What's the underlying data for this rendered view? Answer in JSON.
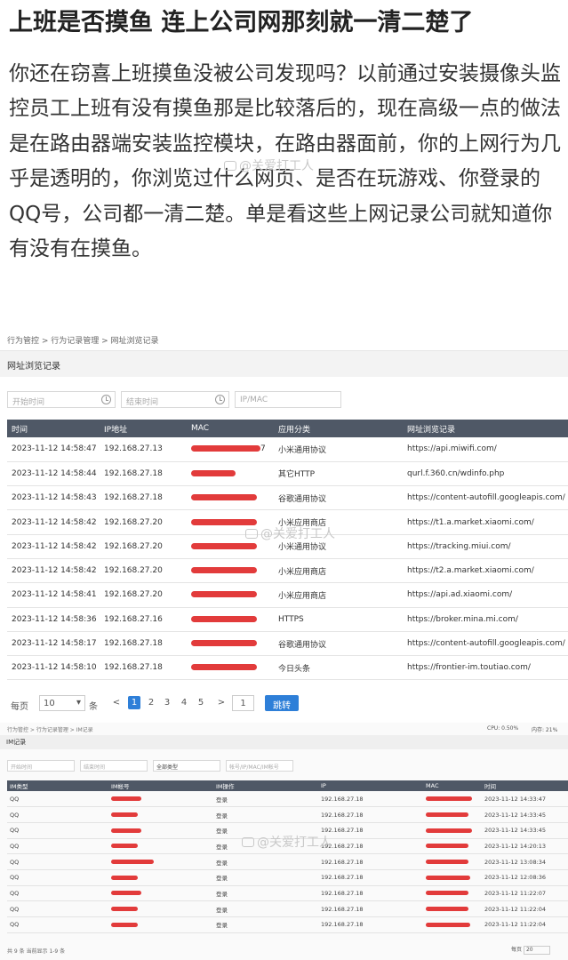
{
  "article": {
    "headline": "上班是否摸鱼 连上公司网那刻就一清二楚了",
    "body": "你还在窃喜上班摸鱼没被公司发现吗？以前通过安装摄像头监控员工上班有没有摸鱼那是比较落后的，现在高级一点的做法是在路由器端安装监控模块，在路由器面前，你的上网行为几乎是透明的，你浏览过什么网页、是否在玩游戏、你登录的QQ号，公司都一清二楚。单是看这些上网记录公司就知道你有没有在摸鱼。"
  },
  "watermark": "@关爱打工人",
  "url_panel": {
    "breadcrumb": "行为管控 > 行为记录管理 > 网址浏览记录",
    "section_title": "网址浏览记录",
    "filters": {
      "start": "开始时间",
      "end": "结束时间",
      "ipmac": "IP/MAC"
    },
    "columns": [
      "时间",
      "IP地址",
      "MAC",
      "应用分类",
      "网址浏览记录"
    ],
    "rows": [
      {
        "time": "2023-11-12 14:58:47",
        "ip": "192.168.27.13",
        "mac_tail": "7",
        "app": "小米通用协议",
        "url": "https://api.miwifi.com/"
      },
      {
        "time": "2023-11-12 14:58:44",
        "ip": "192.168.27.18",
        "mac_tail": "",
        "app": "其它HTTP",
        "url": "qurl.f.360.cn/wdinfo.php"
      },
      {
        "time": "2023-11-12 14:58:43",
        "ip": "192.168.27.18",
        "mac_tail": "",
        "app": "谷歌通用协议",
        "url": "https://content-autofill.googleapis.com/"
      },
      {
        "time": "2023-11-12 14:58:42",
        "ip": "192.168.27.20",
        "mac_tail": "",
        "app": "小米应用商店",
        "url": "https://t1.a.market.xiaomi.com/"
      },
      {
        "time": "2023-11-12 14:58:42",
        "ip": "192.168.27.20",
        "mac_tail": "",
        "app": "小米通用协议",
        "url": "https://tracking.miui.com/"
      },
      {
        "time": "2023-11-12 14:58:42",
        "ip": "192.168.27.20",
        "mac_tail": "",
        "app": "小米应用商店",
        "url": "https://t2.a.market.xiaomi.com/"
      },
      {
        "time": "2023-11-12 14:58:41",
        "ip": "192.168.27.20",
        "mac_tail": "",
        "app": "小米应用商店",
        "url": "https://api.ad.xiaomi.com/"
      },
      {
        "time": "2023-11-12 14:58:36",
        "ip": "192.168.27.16",
        "mac_tail": "",
        "app": "HTTPS",
        "url": "https://broker.mina.mi.com/"
      },
      {
        "time": "2023-11-12 14:58:17",
        "ip": "192.168.27.18",
        "mac_tail": "",
        "app": "谷歌通用协议",
        "url": "https://content-autofill.googleapis.com/"
      },
      {
        "time": "2023-11-12 14:58:10",
        "ip": "192.168.27.18",
        "mac_tail": "",
        "app": "今日头条",
        "url": "https://frontier-im.toutiao.com/"
      }
    ],
    "pagination": {
      "per_page_label": "每页",
      "per_page_value": "10",
      "unit": "条",
      "prev": "<",
      "next": ">",
      "pages": [
        "1",
        "2",
        "3",
        "4",
        "5"
      ],
      "current": "1",
      "goto_value": "1",
      "jump_label": "跳转"
    }
  },
  "im_panel": {
    "breadcrumb": "行为管控 > 行为记录管理 > IM记录",
    "cpu": "CPU: 0.50%",
    "mem": "内存: 21%",
    "section_title": "IM记录",
    "filters": {
      "start": "开始时间",
      "end": "结束时间",
      "type": "全部类型",
      "search": "帐号/IP/MAC/IM帐号"
    },
    "columns": [
      "IM类型",
      "IM帐号",
      "IM操作",
      "IP",
      "MAC",
      "时间"
    ],
    "rows": [
      {
        "type": "QQ",
        "op": "登录",
        "ip": "192.168.27.18",
        "time": "2023-11-12 14:33:47"
      },
      {
        "type": "QQ",
        "op": "登录",
        "ip": "192.168.27.18",
        "time": "2023-11-12 14:33:45"
      },
      {
        "type": "QQ",
        "op": "登录",
        "ip": "192.168.27.18",
        "time": "2023-11-12 14:33:45"
      },
      {
        "type": "QQ",
        "op": "登录",
        "ip": "192.168.27.18",
        "time": "2023-11-12 14:20:13"
      },
      {
        "type": "QQ",
        "op": "登录",
        "ip": "192.168.27.18",
        "time": "2023-11-12 13:08:34"
      },
      {
        "type": "QQ",
        "op": "登录",
        "ip": "192.168.27.18",
        "time": "2023-11-12 12:08:36"
      },
      {
        "type": "QQ",
        "op": "登录",
        "ip": "192.168.27.18",
        "time": "2023-11-12 11:22:07"
      },
      {
        "type": "QQ",
        "op": "登录",
        "ip": "192.168.27.18",
        "time": "2023-11-12 11:22:04"
      },
      {
        "type": "QQ",
        "op": "登录",
        "ip": "192.168.27.18",
        "time": "2023-11-12 11:22:04"
      }
    ],
    "footer": "共 9 条 当前显示 1-9 条",
    "per_page_label": "每页",
    "per_page_value": "20"
  },
  "colors": {
    "header": "#4f5866",
    "redact": "#e23b3b",
    "accent": "#2e7fd8"
  }
}
